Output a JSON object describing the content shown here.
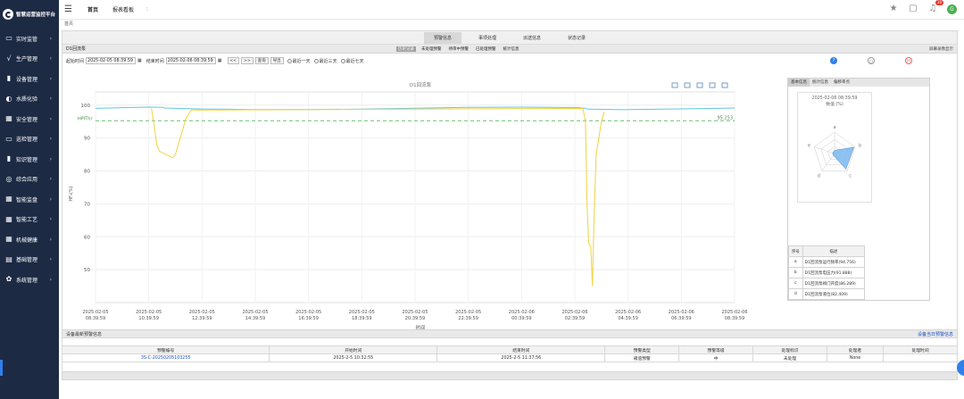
{
  "app": {
    "logo_text": "智慧运营监控平台"
  },
  "sidebar": {
    "items": [
      {
        "label": "实时监管",
        "icon": "monitor-icon",
        "glyph": "▭"
      },
      {
        "label": "生产管理",
        "icon": "trend-icon",
        "glyph": "√"
      },
      {
        "label": "设备管理",
        "icon": "book-icon",
        "glyph": "▮"
      },
      {
        "label": "水质化验",
        "icon": "water-icon",
        "glyph": "◐"
      },
      {
        "label": "安全管理",
        "icon": "grid-icon",
        "glyph": "▦"
      },
      {
        "label": "巡检管理",
        "icon": "monitor-icon",
        "glyph": "▭"
      },
      {
        "label": "知识管理",
        "icon": "book-icon",
        "glyph": "▮"
      },
      {
        "label": "综合应用",
        "icon": "globe-icon",
        "glyph": "◎"
      },
      {
        "label": "智能监盘",
        "icon": "grid-icon",
        "glyph": "▦"
      },
      {
        "label": "智能工艺",
        "icon": "grid-icon",
        "glyph": "▦"
      },
      {
        "label": "机械健康",
        "icon": "grid-icon",
        "glyph": "▦"
      },
      {
        "label": "基础管理",
        "icon": "list-icon",
        "glyph": "▤"
      },
      {
        "label": "系统管理",
        "icon": "gear-icon",
        "glyph": "✿"
      }
    ]
  },
  "topbar": {
    "home": "首页",
    "report": "报表看板",
    "more": "⁝"
  },
  "breadcrumb": "首页",
  "main_tabs": [
    "预警信息",
    "事项处理",
    "派送信息",
    "状态记录"
  ],
  "panel": {
    "title": "D1回流泵",
    "sub_tabs": [
      "历史记录",
      "未处理预警",
      "待审中预警",
      "已处理预警",
      "统计信息"
    ],
    "right_link": "屏幕录像显示"
  },
  "filter": {
    "start_label": "起始时间",
    "start_value": "2025-02-05 08:39:59",
    "end_label": "结束时间",
    "end_value": "2025-02-06 08:39:59",
    "prev": "<<",
    "next": ">>",
    "query": "查询",
    "export": "导出",
    "r1": "最近一天",
    "r2": "最近三天",
    "r3": "最近七天"
  },
  "colors": {
    "cyan": "#5fc7e6",
    "yellow": "#f2d23c",
    "threshold": "#6bbf6b",
    "sidebar": "#1d2a44"
  },
  "chart_data": {
    "type": "line",
    "title": "D1回流泵",
    "ylabel": "HF₃(%)",
    "xlabel": "时间",
    "ylim": [
      40,
      104
    ],
    "yticks": [
      50,
      60,
      70,
      80,
      90,
      100
    ],
    "threshold": {
      "label": "HPIThr",
      "value": 95.25,
      "value_label": "95.253"
    },
    "xticks": [
      "2025-02-05 08:39:59",
      "2025-02-05 10:39:59",
      "2025-02-05 12:39:59",
      "2025-02-05 14:39:59",
      "2025-02-05 16:39:59",
      "2025-02-05 18:39:59",
      "2025-02-05 20:39:59",
      "2025-02-05 22:39:59",
      "2025-02-06 00:39:59",
      "2025-02-06 02:39:59",
      "2025-02-06 04:39:59",
      "2025-02-06 06:39:59",
      "2025-02-06 08:39:59"
    ],
    "series": [
      {
        "color": "#5fc7e6",
        "x": [
          0,
          0.6,
          1.0,
          1.25,
          1.3,
          2.0,
          3.0,
          4.0,
          5.0,
          6.0,
          7.0,
          8.0,
          9.0,
          9.2,
          9.25,
          9.9,
          10.0,
          11.0,
          12.0
        ],
        "y": [
          99,
          99,
          99,
          99,
          99,
          99,
          99,
          99,
          99,
          99,
          99,
          99,
          99,
          99,
          99,
          99,
          99,
          99,
          99
        ]
      },
      {
        "color": "#f2d23c",
        "x": [
          1.05,
          1.1,
          1.15,
          1.2,
          1.45,
          1.5,
          1.7,
          1.8,
          9.15,
          9.2,
          9.23,
          9.26,
          9.3,
          9.33,
          9.36,
          9.4,
          9.5,
          9.55
        ],
        "y": [
          99,
          94,
          88,
          86,
          84,
          85,
          96,
          98.5,
          99,
          95,
          70,
          58,
          57,
          45,
          65,
          85,
          95,
          98
        ]
      }
    ]
  },
  "right_panel": {
    "tabs": [
      "基本信息",
      "统计信息",
      "偏移率点"
    ],
    "radar_time": "2025-02-06 08:39:59",
    "radar_unit": "数值 (%)",
    "radar_axes": [
      "a",
      "b",
      "c",
      "d",
      "e"
    ],
    "radar_values": [
      94.756,
      91.888,
      86.289,
      82.409,
      60
    ],
    "legend_header": [
      "序号",
      "描述"
    ],
    "legend": [
      {
        "key": "a",
        "desc": "D1回流泵运行频率(94.756)"
      },
      {
        "key": "b",
        "desc": "D1回流泵电压力(91.888)"
      },
      {
        "key": "c",
        "desc": "D1回流泵阀门开度(86.289)"
      },
      {
        "key": "d",
        "desc": "D1回流泵液位(82.409)"
      }
    ]
  },
  "bottom": {
    "title": "设备最新预警信息",
    "link": "设备当日预警信息",
    "headers": [
      "预警编号",
      "开始时间",
      "结束时间",
      "预警类型",
      "预警等级",
      "处理标识",
      "处理者",
      "处理时间"
    ],
    "rows": [
      [
        "3S-C-20250205103255",
        "2025-2-5 10:32:55",
        "2025-2-5 11:37:56",
        "阈值预警",
        "中",
        "未处理",
        "None",
        ""
      ]
    ]
  }
}
